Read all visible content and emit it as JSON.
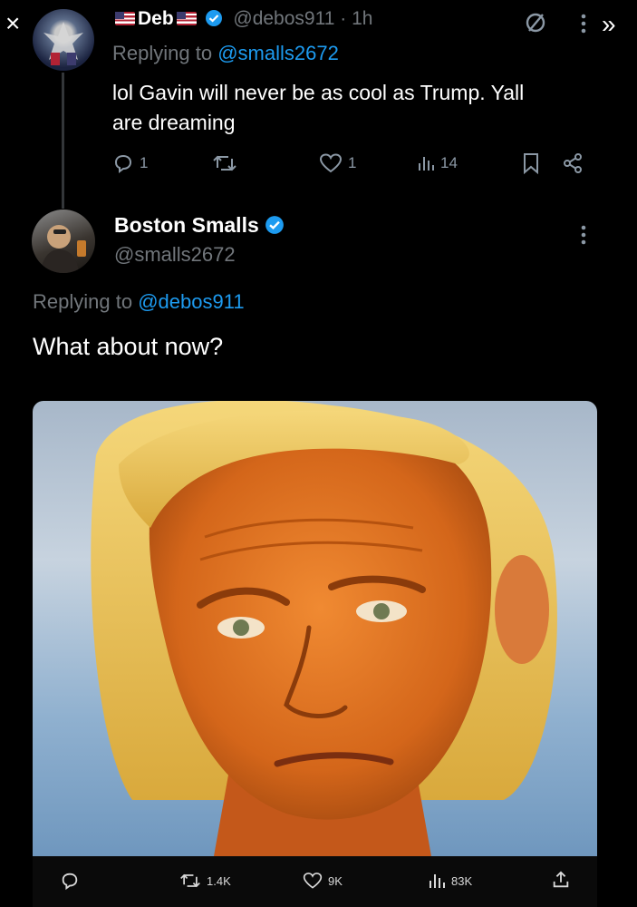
{
  "top_controls": {
    "close_glyph": "×",
    "next_glyph": "»"
  },
  "reply_tweet": {
    "display_name": "Deb",
    "handle": "@debos911",
    "separator": "·",
    "time": "1h",
    "replying_prefix": "Replying to",
    "replying_handle": "@smalls2672",
    "text_line1": "lol Gavin will never be as cool as Trump. Yall",
    "text_line2": "are dreaming",
    "replies": "1",
    "likes": "1",
    "views": "14"
  },
  "main_tweet": {
    "display_name": "Boston Smalls",
    "handle": "@smalls2672",
    "replying_prefix": "Replying to",
    "replying_handle": "@debos911",
    "text": "What about now?",
    "image_description_icon": "photo",
    "retweets": "1.4K",
    "likes": "9K",
    "views": "83K"
  },
  "colors": {
    "background": "#000000",
    "accent": "#1d9bf0",
    "muted": "#71767b"
  }
}
